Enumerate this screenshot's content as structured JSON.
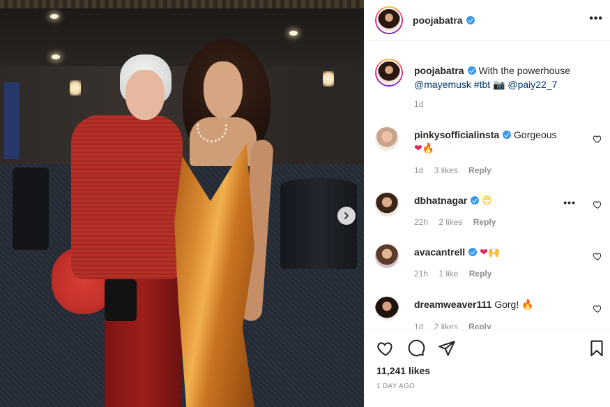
{
  "post": {
    "author": "poojabatra",
    "more_label": "•••",
    "caption": {
      "text_1": "With the powerhouse",
      "mention_1": "@mayemusk",
      "hashtag": "#tbt",
      "camera_emoji": "📷",
      "mention_2": "@paiy22_7",
      "time": "1d"
    },
    "likes": "11,241 likes",
    "date": "1 DAY AGO"
  },
  "comments": [
    {
      "user": "pinkysofficialinsta",
      "text": "Gorgeous",
      "emojis": [
        "❤",
        "🔥"
      ],
      "time": "1d",
      "likes": "3 likes",
      "reply": "Reply",
      "verified": true
    },
    {
      "user": "dbhatnagar",
      "text": "",
      "emojis": [
        "😍"
      ],
      "time": "22h",
      "likes": "2 likes",
      "reply": "Reply",
      "verified": true,
      "more": "•••"
    },
    {
      "user": "avacantrell",
      "text": "",
      "emojis": [
        "❤",
        "🙌"
      ],
      "time": "21h",
      "likes": "1 like",
      "reply": "Reply",
      "verified": true
    },
    {
      "user": "dreamweaver111",
      "text": "Gorg!",
      "emojis": [
        "🔥"
      ],
      "time": "1d",
      "likes": "2 likes",
      "reply": "Reply",
      "verified": false
    }
  ],
  "icons": {
    "next": "chevron-right-icon",
    "like": "heart-icon",
    "comment": "comment-icon",
    "share": "paper-plane-icon",
    "save": "bookmark-icon"
  },
  "colors": {
    "link": "#00376b",
    "verified": "#3897f0",
    "meta": "#8e8e8e"
  }
}
